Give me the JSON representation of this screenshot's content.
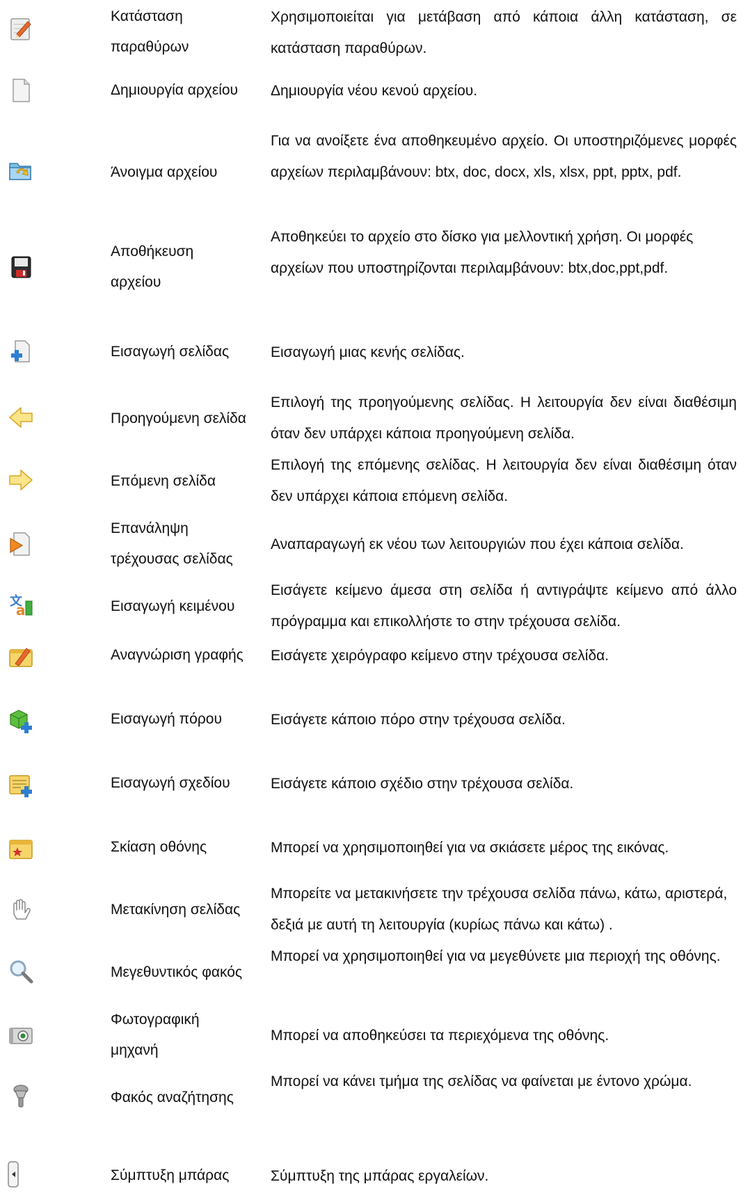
{
  "rows": [
    {
      "icon": "window-mode-icon",
      "name": "Κατάσταση παραθύρων",
      "description": "Χρησιμοποιείται για μετάβαση από κάποια άλλη κατάσταση, σε κατάσταση παραθύρων."
    },
    {
      "icon": "new-file-icon",
      "name": "Δημιουργία αρχείου",
      "description": "Δημιουργία νέου κενού αρχείου."
    },
    {
      "icon": "open-folder-icon",
      "name": "Άνοιγμα αρχείου",
      "description": "Για να ανοίξετε ένα αποθηκευμένο αρχείο. Οι υποστηριζόμενες μορφές αρχείων περιλαμβάνουν: btx, doc, docx, xls, xlsx, ppt, pptx, pdf."
    },
    {
      "icon": "save-disk-icon",
      "name": "Αποθήκευση αρχείου",
      "description": "Αποθηκεύει το αρχείο στο δίσκο για μελλοντική χρήση. Οι μορφές αρχείων που υποστηρίζονται περιλαμβάνουν: btx,doc,ppt,pdf."
    },
    {
      "icon": "insert-page-icon",
      "name": "Εισαγωγή σελίδας",
      "description": "Εισαγωγή μιας κενής σελίδας."
    },
    {
      "icon": "arrow-left-icon",
      "name": "Προηγούμενη σελίδα",
      "description": "Επιλογή της προηγούμενης σελίδας. Η λειτουργία δεν είναι διαθέσιμη όταν δεν υπάρχει κάποια προηγούμενη σελίδα."
    },
    {
      "icon": "arrow-right-icon",
      "name": "Επόμενη σελίδα",
      "description": "Επιλογή της επόμενης σελίδας. Η λειτουργία δεν είναι διαθέσιμη όταν δεν υπάρχει κάποια επόμενη σελίδα."
    },
    {
      "icon": "replay-page-icon",
      "name": "Επανάληψη τρέχουσας σελίδας",
      "description": "Αναπαραγωγή εκ νέου των λειτουργιών που έχει κάποια σελίδα."
    },
    {
      "icon": "insert-text-icon",
      "name": "Εισαγωγή κειμένου",
      "description": "Εισάγετε κείμενο άμεσα στη σελίδα ή αντιγράψτε κείμενο από άλλο πρόγραμμα και επικολλήστε το στην τρέχουσα σελίδα."
    },
    {
      "icon": "handwriting-icon",
      "name": "Αναγνώριση γραφής",
      "description": "Εισάγετε χειρόγραφο κείμενο στην τρέχουσα σελίδα."
    },
    {
      "icon": "insert-resource-icon",
      "name": "Εισαγωγή πόρου",
      "description": "Εισάγετε κάποιο πόρο στην τρέχουσα σελίδα."
    },
    {
      "icon": "insert-design-icon",
      "name": "Εισαγωγή σχεδίου",
      "description": "Εισάγετε κάποιο σχέδιο στην τρέχουσα σελίδα."
    },
    {
      "icon": "screen-shade-icon",
      "name": "Σκίαση οθόνης",
      "description": "Μπορεί να χρησιμοποιηθεί για να σκιάσετε μέρος της εικόνας."
    },
    {
      "icon": "hand-pan-icon",
      "name": "Μετακίνηση σελίδας",
      "description": "Μπορείτε να μετακινήσετε την τρέχουσα σελίδα πάνω, κάτω, αριστερά, δεξιά με αυτή τη λειτουργία (κυρίως πάνω και κάτω) ."
    },
    {
      "icon": "magnifier-icon",
      "name": "Μεγεθυντικός φακός",
      "description": "Μπορεί να χρησιμοποιηθεί για να μεγεθύνετε μια περιοχή της οθόνης."
    },
    {
      "icon": "camera-icon",
      "name": "Φωτογραφική μηχανή",
      "description": "Μπορεί να αποθηκεύσει τα περιεχόμενα της οθόνης."
    },
    {
      "icon": "spotlight-icon",
      "name": "Φακός αναζήτησης",
      "description": "Μπορεί να κάνει τμήμα της σελίδας να φαίνεται με έντονο χρώμα."
    },
    {
      "icon": "collapse-bar-icon",
      "name": "Σύμπτυξη μπάρας",
      "description": "Σύμπτυξη της μπάρας εργαλείων."
    }
  ]
}
